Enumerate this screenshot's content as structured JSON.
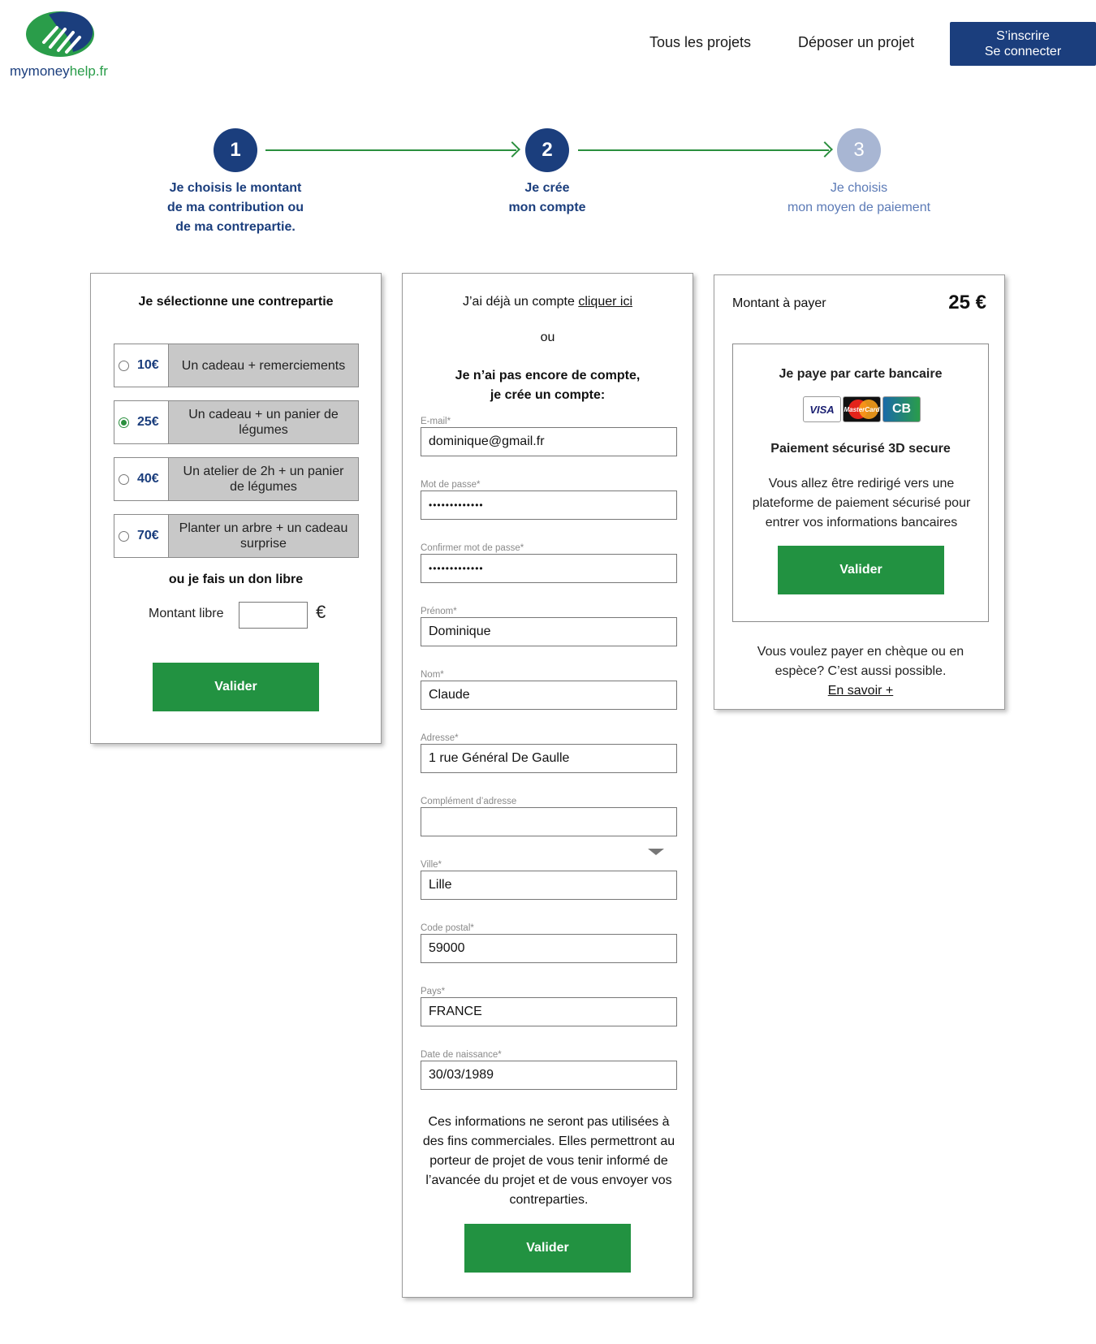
{
  "header": {
    "logo_text_main": "mymoney",
    "logo_text_accent": "help.fr",
    "nav": [
      "Tous les projets",
      "Déposer un projet"
    ],
    "auth": {
      "signup": "S’inscrire",
      "login": "Se connecter"
    }
  },
  "stepper": {
    "steps": [
      {
        "number": "1",
        "label_lines": [
          "Je choisis le montant",
          "de ma contribution ou",
          "de ma contrepartie."
        ],
        "state": "active"
      },
      {
        "number": "2",
        "label_lines": [
          "Je crée",
          "mon compte"
        ],
        "state": "active"
      },
      {
        "number": "3",
        "label_lines": [
          "Je choisis",
          "mon moyen de paiement"
        ],
        "state": "inactive"
      }
    ]
  },
  "rewards": {
    "title": "Je sélectionne une contrepartie",
    "options": [
      {
        "amount": "10€",
        "description": "Un cadeau + remerciements",
        "selected": false
      },
      {
        "amount": "25€",
        "description": "Un cadeau + un panier de légumes",
        "selected": true
      },
      {
        "amount": "40€",
        "description": "Un atelier de 2h + un panier de légumes",
        "selected": false
      },
      {
        "amount": "70€",
        "description": "Planter un arbre + un cadeau surprise",
        "selected": false
      }
    ],
    "free_title": "ou je fais un don libre",
    "free_label": "Montant libre",
    "free_value": "",
    "currency": "€",
    "submit": "Valider"
  },
  "account": {
    "existing_prefix": "J’ai déjà un compte ",
    "existing_link": "cliquer ici",
    "or": "ou",
    "new_line1": "Je n’ai pas encore de compte,",
    "new_line2": "je crée un compte:",
    "fields": [
      {
        "label": "E-mail*",
        "value": "dominique@gmail.fr"
      },
      {
        "label": "Mot de passe*",
        "value": "•••••••••••••"
      },
      {
        "label": "Confirmer mot de passe*",
        "value": "•••••••••••••"
      },
      {
        "label": "Prénom*",
        "value": "Dominique"
      },
      {
        "label": "Nom*",
        "value": "Claude"
      },
      {
        "label": "Adresse*",
        "value": "1 rue Général De Gaulle"
      },
      {
        "label": "Complément d’adresse",
        "value": ""
      },
      {
        "label": "Ville*",
        "value": "Lille"
      },
      {
        "label": "Code postal*",
        "value": "59000"
      },
      {
        "label": "Pays*",
        "value": "FRANCE"
      },
      {
        "label": "Date de naissance*",
        "value": "30/03/1989"
      }
    ],
    "note": "Ces informations ne seront pas utilisées à des fins commerciales. Elles permettront au porteur de projet de vous tenir informé de l’avancée du projet et de vous envoyer vos contreparties.",
    "submit": "Valider"
  },
  "payment": {
    "amount_label": "Montant à payer",
    "amount": "25 €",
    "card_title": "Je paye par carte bancaire",
    "card_logos": {
      "visa": "VISA",
      "mastercard": "MasterCard",
      "cb": "CB"
    },
    "secure": "Paiement sécurisé 3D secure",
    "redirect": "Vous allez être redirigé vers une plateforme de paiement sécurisé pour entrer vos informations bancaires",
    "submit": "Valider",
    "alt_text": "Vous voulez payer en chèque ou en espèce? C’est aussi possible.",
    "alt_link": "En savoir +"
  },
  "colors": {
    "brand_blue": "#1b3e7d",
    "brand_green": "#229241",
    "step_inactive": "#a8b6d3"
  }
}
